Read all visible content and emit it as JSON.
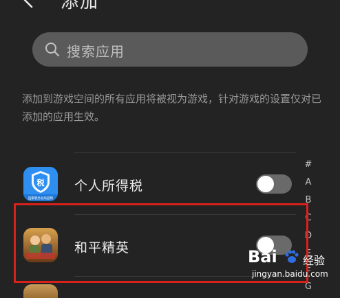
{
  "header": {
    "title": "添加"
  },
  "search": {
    "placeholder": "搜索应用"
  },
  "description": "添加到游戏空间的所有应用将被视为游戏，针对游戏的设置仅对已添加的应用生效。",
  "apps": [
    {
      "name": "个人所得税",
      "enabled": false,
      "icon": "tax-app-icon",
      "icon_text": "税",
      "icon_subtext": "国家税务总局监制"
    },
    {
      "name": "和平精英",
      "enabled": false,
      "icon": "peace-elite-app-icon"
    }
  ],
  "index_letters": [
    "#",
    "A",
    "B",
    "C",
    "D",
    "E",
    "F",
    "G"
  ],
  "watermark": {
    "logo": "Bai",
    "cn": "经验",
    "url": "jingyan.baidu.com"
  },
  "colors": {
    "background": "#232323",
    "search_bg": "#5a5a5a",
    "toggle_off": "#6a6a6a",
    "highlight": "#d9211c",
    "tax_icon": "#2e8ff0"
  }
}
